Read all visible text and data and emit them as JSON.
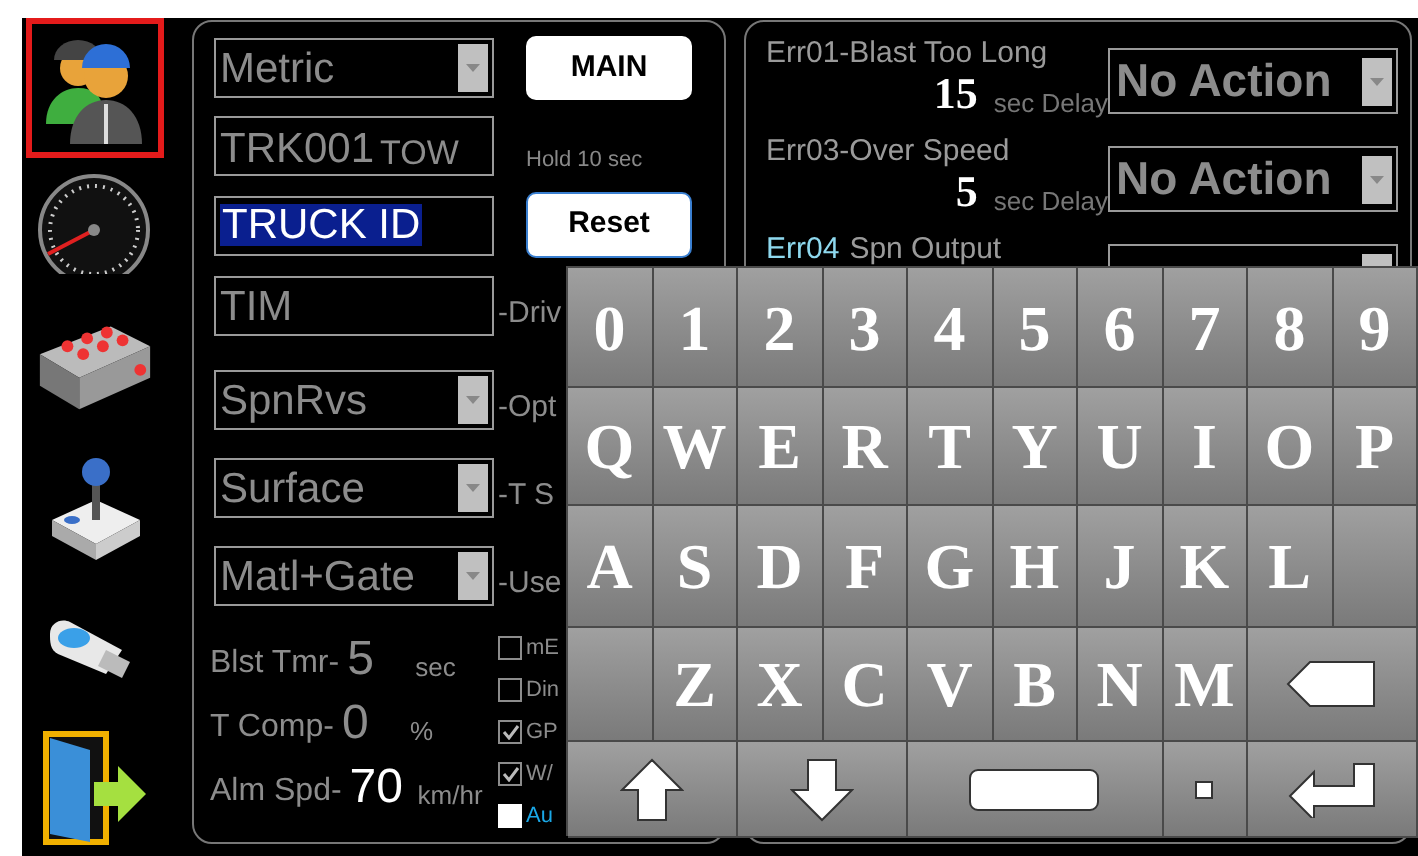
{
  "sidebar": {
    "items": [
      {
        "kind": "users",
        "selected": true
      },
      {
        "kind": "speedometer",
        "selected": false
      },
      {
        "kind": "valve",
        "selected": false
      },
      {
        "kind": "joystick",
        "selected": false
      },
      {
        "kind": "usb",
        "selected": false
      },
      {
        "kind": "exit",
        "selected": false
      }
    ]
  },
  "settings": {
    "unit_select": "Metric",
    "main_button": "MAIN",
    "truck_field": {
      "value": "TRK001",
      "suffix": "TOW"
    },
    "hold_hint": "Hold 10 sec",
    "id_field": {
      "value": "TRUCK ID",
      "selected": true
    },
    "reset_button": "Reset",
    "driver_field": {
      "value": "TIM",
      "label": "-Driv"
    },
    "selects": [
      {
        "value": "SpnRvs",
        "label": "-Opt"
      },
      {
        "value": "Surface",
        "label": "-T S"
      },
      {
        "value": "Matl+Gate",
        "label": "-Use"
      }
    ],
    "readings": [
      {
        "label": "Blst Tmr-",
        "value": "5",
        "unit": "sec",
        "highlight": false
      },
      {
        "label": "T Comp-",
        "value": "0",
        "unit": "%",
        "highlight": false
      },
      {
        "label": "Alm Spd-",
        "value": "70",
        "unit": "km/hr",
        "highlight": true
      }
    ],
    "checkboxes": [
      {
        "label": "mE",
        "checked": false,
        "disabled": false
      },
      {
        "label": "Din",
        "checked": false,
        "disabled": false
      },
      {
        "label": "GP",
        "checked": true,
        "disabled": false
      },
      {
        "label": "W/",
        "checked": true,
        "disabled": false
      },
      {
        "label": "Au",
        "checked": false,
        "disabled": true
      }
    ]
  },
  "errors": [
    {
      "code": "Err01-Blast Too Long",
      "delay": "15",
      "delay_unit": "sec Delay",
      "action": "No Action",
      "kind": "delay"
    },
    {
      "code": "Err03-Over Speed",
      "delay": "5",
      "delay_unit": "sec Delay",
      "action": "No Action",
      "kind": "delay"
    },
    {
      "code": "Err04",
      "name": "Spn Output",
      "kind": "output"
    }
  ],
  "keyboard": {
    "keys": [
      {
        "kind": "char",
        "label": "0"
      },
      {
        "kind": "char",
        "label": "1"
      },
      {
        "kind": "char",
        "label": "2"
      },
      {
        "kind": "char",
        "label": "3"
      },
      {
        "kind": "char",
        "label": "4"
      },
      {
        "kind": "char",
        "label": "5"
      },
      {
        "kind": "char",
        "label": "6"
      },
      {
        "kind": "char",
        "label": "7"
      },
      {
        "kind": "char",
        "label": "8"
      },
      {
        "kind": "char",
        "label": "9"
      },
      {
        "kind": "char",
        "label": "Q"
      },
      {
        "kind": "char",
        "label": "W"
      },
      {
        "kind": "char",
        "label": "E"
      },
      {
        "kind": "char",
        "label": "R"
      },
      {
        "kind": "char",
        "label": "T"
      },
      {
        "kind": "char",
        "label": "Y"
      },
      {
        "kind": "char",
        "label": "U"
      },
      {
        "kind": "char",
        "label": "I"
      },
      {
        "kind": "char",
        "label": "O"
      },
      {
        "kind": "char",
        "label": "P"
      },
      {
        "kind": "char",
        "label": "A"
      },
      {
        "kind": "char",
        "label": "S"
      },
      {
        "kind": "char",
        "label": "D"
      },
      {
        "kind": "char",
        "label": "F"
      },
      {
        "kind": "char",
        "label": "G"
      },
      {
        "kind": "char",
        "label": "H"
      },
      {
        "kind": "char",
        "label": "J"
      },
      {
        "kind": "char",
        "label": "K"
      },
      {
        "kind": "char",
        "label": "L"
      },
      {
        "kind": "blank"
      },
      {
        "kind": "blank"
      },
      {
        "kind": "char",
        "label": "Z"
      },
      {
        "kind": "char",
        "label": "X"
      },
      {
        "kind": "char",
        "label": "C"
      },
      {
        "kind": "char",
        "label": "V"
      },
      {
        "kind": "char",
        "label": "B"
      },
      {
        "kind": "char",
        "label": "N"
      },
      {
        "kind": "char",
        "label": "M"
      },
      {
        "kind": "backspace"
      },
      {
        "kind": "shift"
      },
      {
        "kind": "down"
      },
      {
        "kind": "space"
      },
      {
        "kind": "dot"
      },
      {
        "kind": "enter"
      }
    ]
  }
}
